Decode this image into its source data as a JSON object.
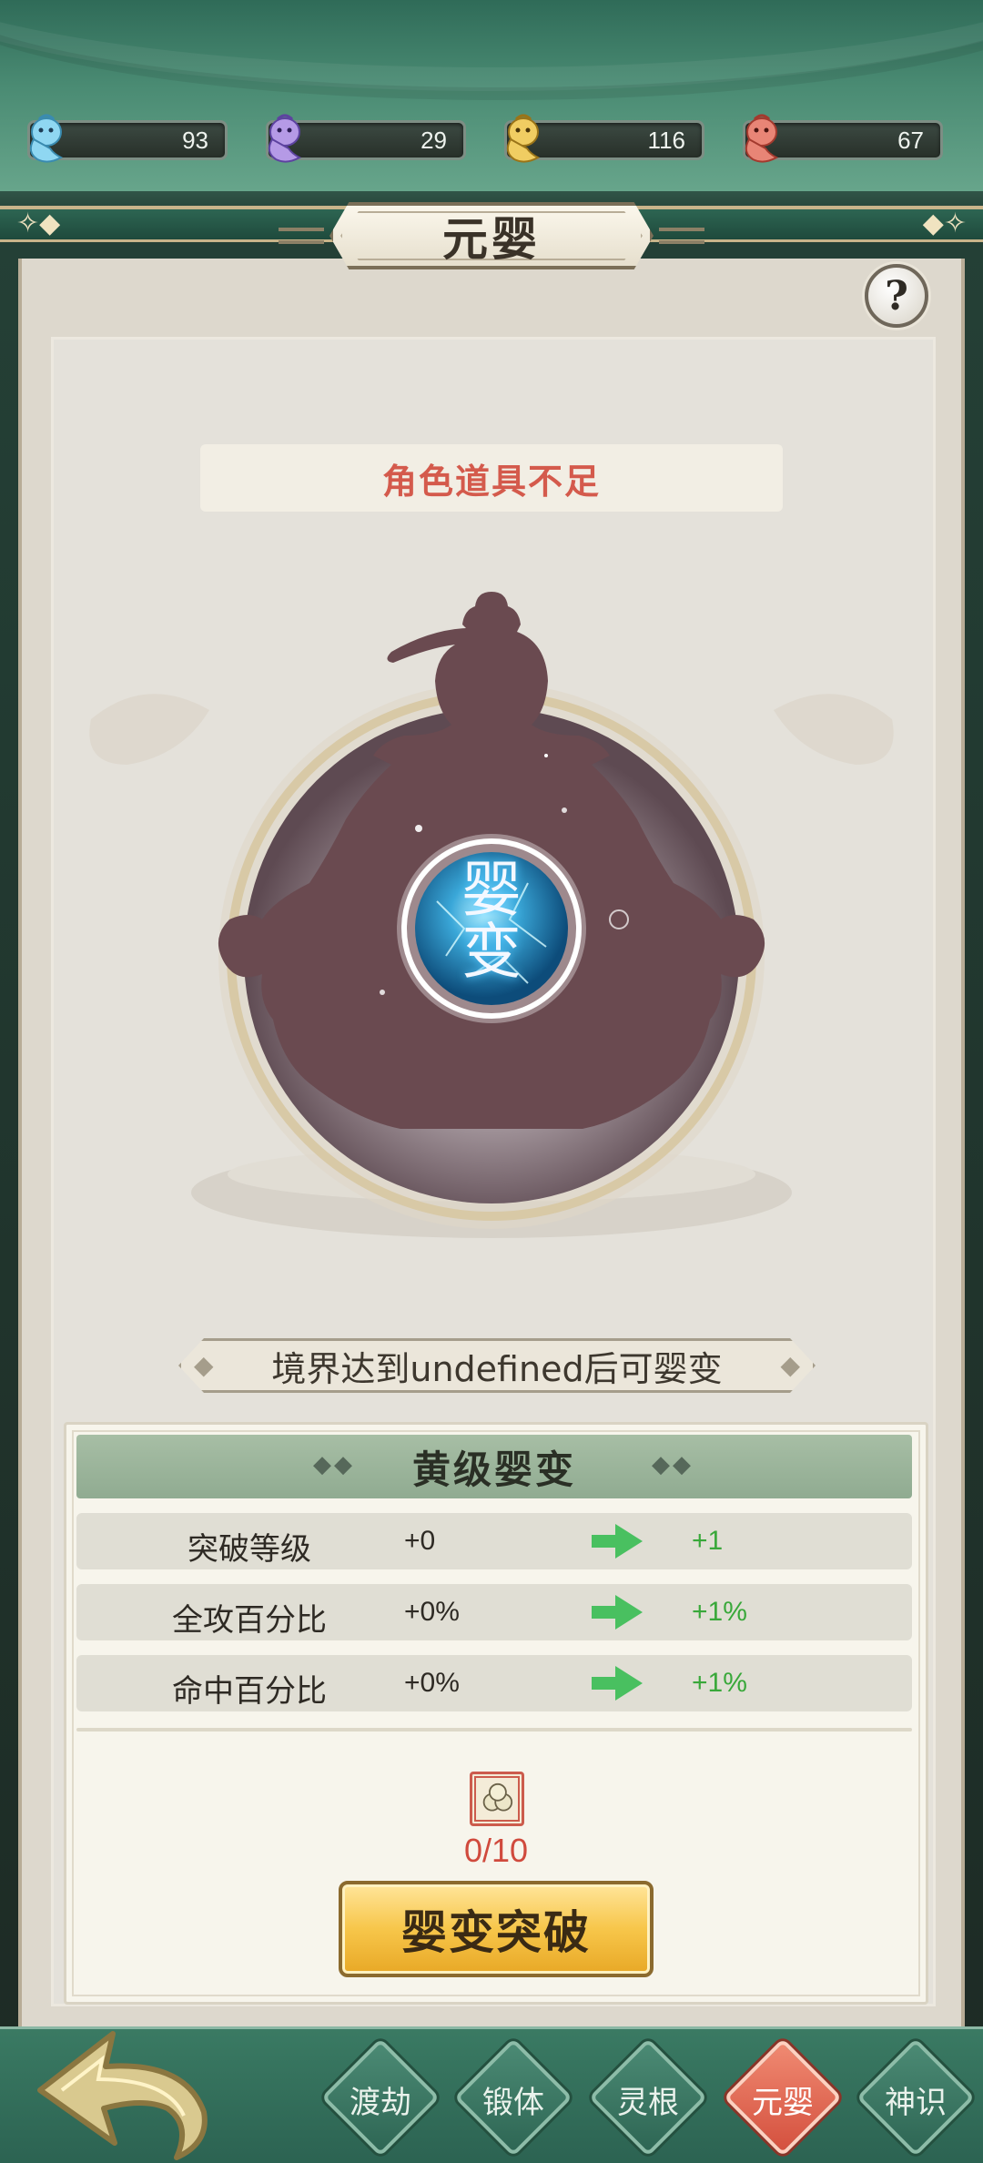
{
  "resources": [
    {
      "name": "blue-spirit",
      "value": "93",
      "color": "#7fd0ef"
    },
    {
      "name": "purple-spirit",
      "value": "29",
      "color": "#a98ce0"
    },
    {
      "name": "gold-spirit",
      "value": "116",
      "color": "#e3b743"
    },
    {
      "name": "red-spirit",
      "value": "67",
      "color": "#d9665a"
    }
  ],
  "header": {
    "title": "元婴",
    "help_label": "?"
  },
  "status": {
    "warning": "角色道具不足"
  },
  "art": {
    "orb_top": "婴",
    "orb_bottom": "变"
  },
  "requirement": "境界达到undefined后可婴变",
  "stage": {
    "title": "黄级婴变",
    "rows": [
      {
        "name": "突破等级",
        "current": "+0",
        "next": "+1"
      },
      {
        "name": "全攻百分比",
        "current": "+0%",
        "next": "+1%"
      },
      {
        "name": "命中百分比",
        "current": "+0%",
        "next": "+1%"
      }
    ]
  },
  "cost": {
    "count": "0/10"
  },
  "action": {
    "label": "婴变突破"
  },
  "nav": {
    "tabs": [
      {
        "label": "渡劫",
        "active": false
      },
      {
        "label": "锻体",
        "active": false
      },
      {
        "label": "灵根",
        "active": false
      },
      {
        "label": "元婴",
        "active": true
      },
      {
        "label": "神识",
        "active": false
      }
    ]
  },
  "colors": {
    "accent_red": "#d45a4c",
    "buff_green": "#39a83a",
    "button_gold": "#f7c64a"
  }
}
